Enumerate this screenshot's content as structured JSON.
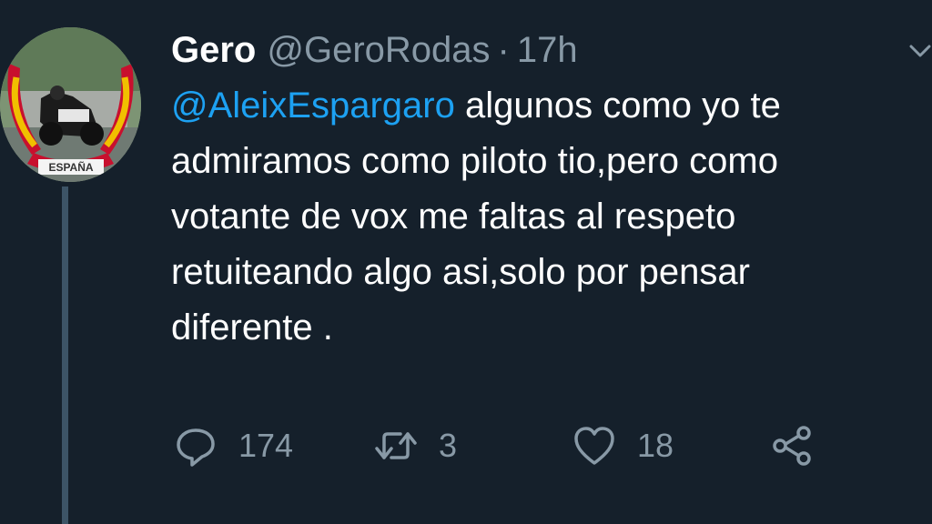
{
  "tweet": {
    "author": {
      "name": "Gero",
      "handle": "@GeroRodas",
      "separator": "·",
      "time": "17h"
    },
    "mention": "@AleixEspargaro",
    "text": " algunos como yo te\nadmiramos como piloto tio,pero como\nvotante de vox me faltas al respeto\nretuiteando algo asi,solo por pensar\ndiferente .",
    "actions": {
      "replies": "174",
      "retweets": "3",
      "likes": "18"
    },
    "avatar_badge_text": "ESPAÑA"
  },
  "colors": {
    "background": "#15202b",
    "text": "#ffffff",
    "secondary": "#8899a6",
    "mention": "#1da1f2",
    "thread_line": "#3d5466"
  },
  "icons": [
    "chevron-down-icon",
    "reply-icon",
    "retweet-icon",
    "like-icon",
    "share-icon"
  ]
}
